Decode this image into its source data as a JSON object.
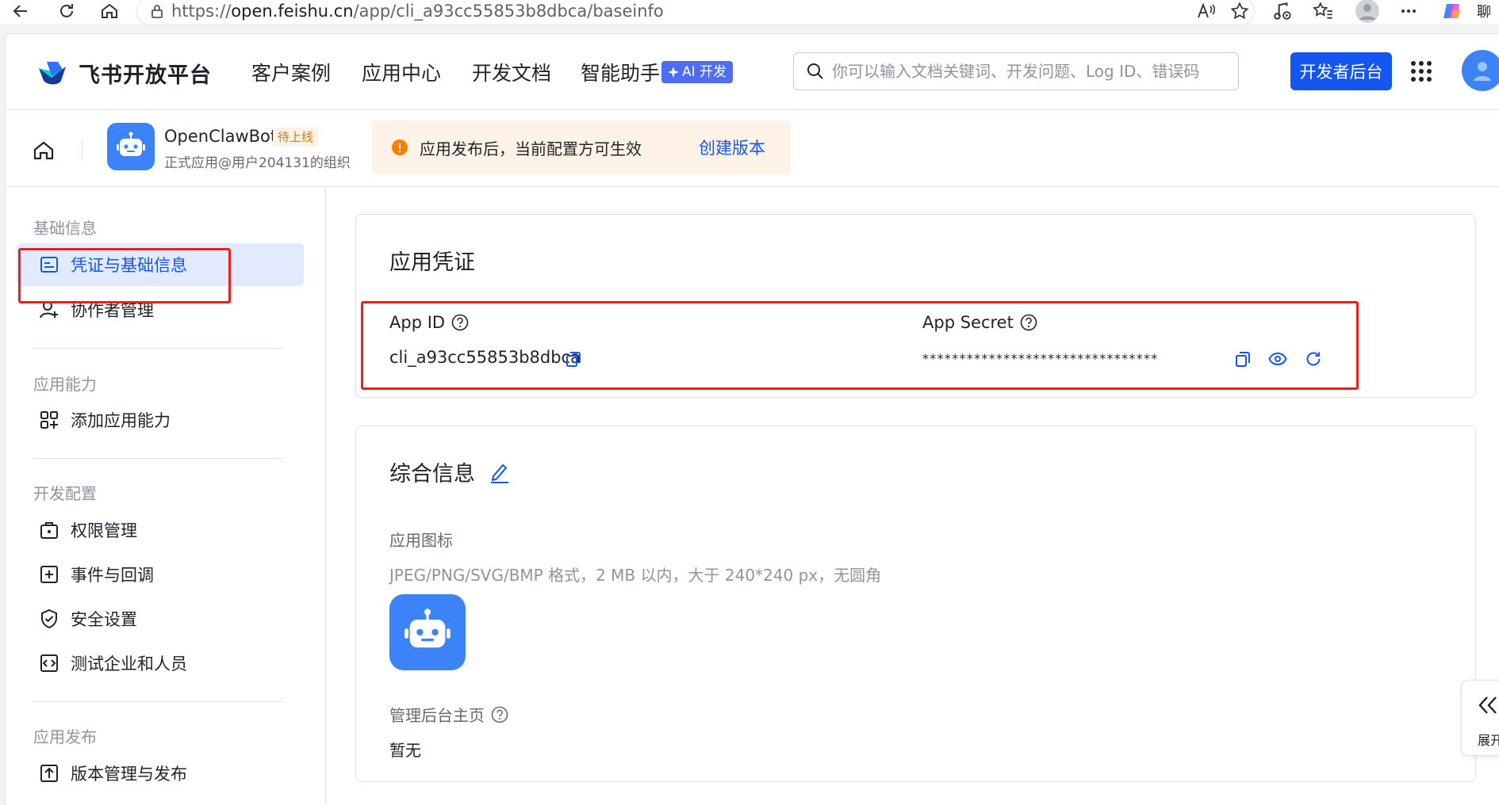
{
  "browser": {
    "url_prefix": "https://",
    "url_host": "open.feishu.cn",
    "url_path": "/app/cli_a93cc55853b8dbca/baseinfo",
    "right_label": "聊"
  },
  "topnav": {
    "brand": "飞书开放平台",
    "items": [
      "客户案例",
      "应用中心",
      "开发文档",
      "智能助手"
    ],
    "ai_badge": "AI 开发",
    "search_placeholder": "你可以输入文档关键词、开发问题、Log ID、错误码",
    "dev_button": "开发者后台"
  },
  "app_header": {
    "name": "OpenClawBot",
    "status": "待上线",
    "org": "正式应用@用户204131的组织",
    "notice": "应用发布后，当前配置方可生效",
    "notice_link": "创建版本"
  },
  "sidebar": {
    "groups": [
      "基础信息",
      "应用能力",
      "开发配置",
      "应用发布"
    ],
    "items": [
      "凭证与基础信息",
      "协作者管理",
      "添加应用能力",
      "权限管理",
      "事件与回调",
      "安全设置",
      "测试企业和人员",
      "版本管理与发布"
    ]
  },
  "credentials": {
    "title": "应用凭证",
    "app_id_label": "App ID",
    "app_id_value": "cli_a93cc55853b8dbca",
    "app_secret_label": "App Secret",
    "app_secret_value": "********************************"
  },
  "general": {
    "title": "综合信息",
    "icon_label": "应用图标",
    "icon_hint": "JPEG/PNG/SVG/BMP 格式，2 MB 以内，大于 240*240 px，无圆角",
    "admin_label": "管理后台主页",
    "admin_value": "暂无"
  },
  "expand_tab": {
    "label": "展开"
  },
  "colors": {
    "primary": "#1456f0",
    "highlight": "#e8221b",
    "warning": "#ff7d00",
    "app_icon": "#3b83f7"
  }
}
